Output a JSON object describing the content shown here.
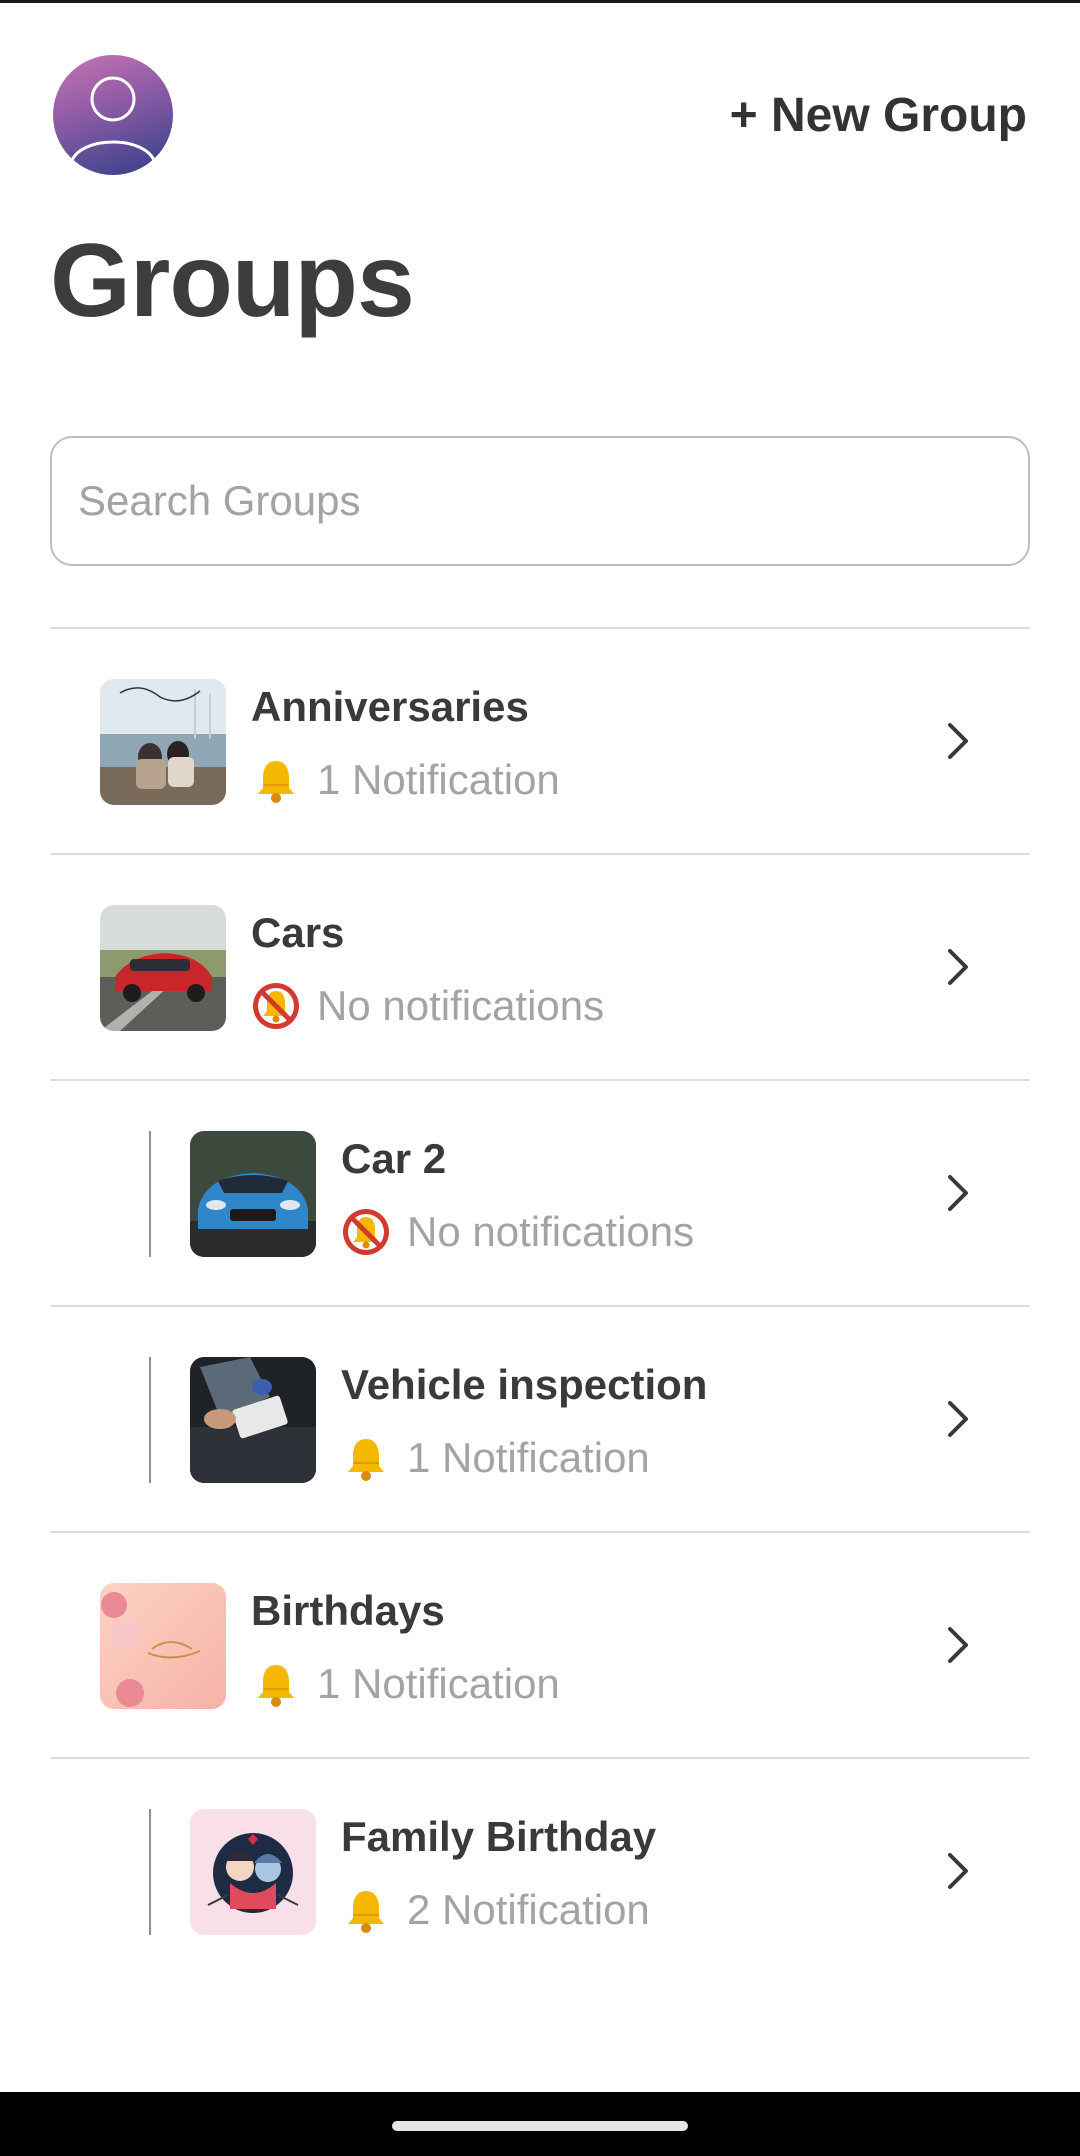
{
  "header": {
    "avatar_icon": "user-avatar-icon",
    "new_group_label": "+ New Group"
  },
  "page_title": "Groups",
  "search": {
    "placeholder": "Search Groups",
    "value": ""
  },
  "groups": [
    {
      "title": "Anniversaries",
      "notification": "1 Notification",
      "icon": "bell-icon",
      "nested": false,
      "image": "couple-photo"
    },
    {
      "title": "Cars",
      "notification": "No notifications",
      "icon": "bell-muted-icon",
      "nested": false,
      "image": "red-car-photo"
    },
    {
      "title": "Car 2",
      "notification": "No notifications",
      "icon": "bell-muted-icon",
      "nested": true,
      "image": "blue-car-photo"
    },
    {
      "title": "Vehicle inspection",
      "notification": "1 Notification",
      "icon": "bell-icon",
      "nested": true,
      "image": "inspection-photo"
    },
    {
      "title": "Birthdays",
      "notification": "1 Notification",
      "icon": "bell-icon",
      "nested": false,
      "image": "birthday-card"
    },
    {
      "title": "Family Birthday",
      "notification": "2 Notification",
      "icon": "bell-icon",
      "nested": true,
      "image": "family-illustration"
    }
  ],
  "colors": {
    "text": "#3d3d3d",
    "muted": "#a3a3a3",
    "divider": "#dcdcdc",
    "bell": "#f5b800",
    "muted_bell": "#d23a2f"
  }
}
